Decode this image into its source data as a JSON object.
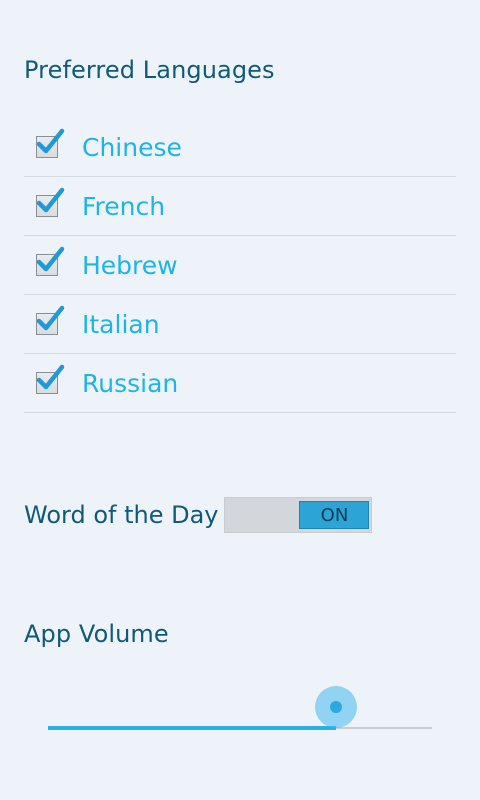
{
  "preferred_languages": {
    "title": "Preferred Languages",
    "items": [
      {
        "label": "Chinese",
        "checked": true
      },
      {
        "label": "French",
        "checked": true
      },
      {
        "label": "Hebrew",
        "checked": true
      },
      {
        "label": "Italian",
        "checked": true
      },
      {
        "label": "Russian",
        "checked": true
      }
    ]
  },
  "word_of_the_day": {
    "label": "Word of the Day",
    "toggle_text": "ON",
    "enabled": true
  },
  "app_volume": {
    "label": "App Volume",
    "value_fraction": 0.75
  },
  "colors": {
    "accent": "#1fb3e6",
    "heading": "#0f5a78",
    "background": "#eef3fa",
    "toggle_on": "#2da4d6"
  },
  "icons": {
    "checkbox": "checkmark-icon"
  }
}
